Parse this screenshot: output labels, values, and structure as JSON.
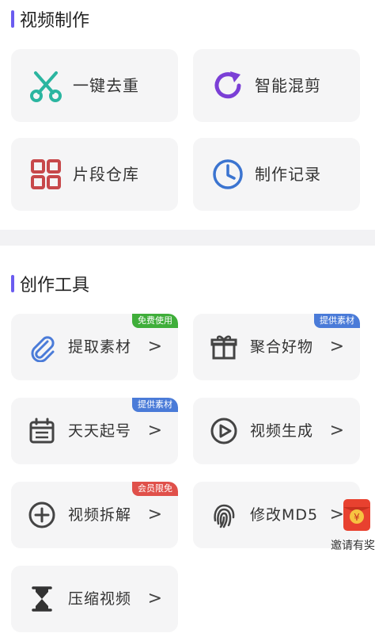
{
  "sections": {
    "video_making": {
      "title": "视频制作",
      "items": [
        {
          "label": "一键去重",
          "icon": "scissors-icon"
        },
        {
          "label": "智能混剪",
          "icon": "refresh-icon"
        },
        {
          "label": "片段仓库",
          "icon": "grid-icon"
        },
        {
          "label": "制作记录",
          "icon": "clock-icon"
        }
      ]
    },
    "creation_tools": {
      "title": "创作工具",
      "items": [
        {
          "label": "提取素材",
          "badge": "免费使用",
          "icon": "paperclip-icon"
        },
        {
          "label": "聚合好物",
          "badge": "提供素材",
          "icon": "gift-icon"
        },
        {
          "label": "天天起号",
          "badge": "提供素材",
          "icon": "calendar-icon"
        },
        {
          "label": "视频生成",
          "icon": "play-icon"
        },
        {
          "label": "视频拆解",
          "badge": "会员限免",
          "icon": "plus-circle-icon"
        },
        {
          "label": "修改MD5",
          "icon": "fingerprint-icon"
        },
        {
          "label": "压缩视频",
          "icon": "hourglass-icon"
        }
      ],
      "chevron": ">"
    }
  },
  "floating": {
    "label": "邀请有奖",
    "icon": "red-packet-icon",
    "packet_char": "¥"
  },
  "colors": {
    "accent_bar": "#6b5cf0",
    "badge_green": "#3fae3a",
    "badge_blue": "#4a7bd8",
    "badge_red": "#e0504a"
  }
}
